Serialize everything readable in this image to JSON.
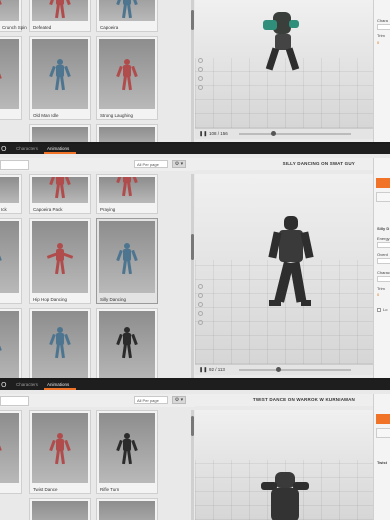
{
  "panel1": {
    "tiles_top": [
      {
        "label": "Crunch Spin"
      },
      {
        "label": "Defeated"
      },
      {
        "label": "Capoeira"
      }
    ],
    "tiles_mid": [
      {
        "label": ""
      },
      {
        "label": "Old Man Idle"
      },
      {
        "label": "Strong Laughing"
      }
    ],
    "player": {
      "frames": "108 / 156",
      "progress": 0.3
    }
  },
  "panel2": {
    "topbar": {
      "logo": "O",
      "tab_characters": "Characters",
      "tab_animations": "Animations"
    },
    "toolbar": {
      "per_page": "All Per page",
      "gear": "⚙ ▾"
    },
    "viewer_title": "SILLY DANCING ON SWAT GUY",
    "tiles_row1": [
      {
        "label": "Ick"
      },
      {
        "label": "Capoeira Pack"
      },
      {
        "label": "Praying"
      }
    ],
    "tiles_row2": [
      {
        "label": ""
      },
      {
        "label": "Hip Hop Dancing"
      },
      {
        "label": "Silly Dancing"
      }
    ],
    "player": {
      "frames": "92 / 113",
      "progress": 0.35
    },
    "settings": {
      "label_silly": "Silly D",
      "energy": "Energy",
      "overdrive": "Overd",
      "character_arm": "Charac",
      "trim": "Trim",
      "in_place": "Lo",
      "field_value_1": "0",
      "field_value_2": "0"
    }
  },
  "panel3": {
    "topbar": {
      "logo": "O",
      "tab_characters": "Characters",
      "tab_animations": "Animations"
    },
    "toolbar": {
      "per_page": "All Per page",
      "gear": "⚙ ▾"
    },
    "viewer_title": "TWIST DANCE ON WARROK W KURNIAWAN",
    "tiles_row1": [
      {
        "label": ""
      },
      {
        "label": "Twist Dance"
      },
      {
        "label": "Rifle Turn"
      }
    ],
    "settings": {
      "label_twist": "Twist"
    }
  },
  "panel1_settings": {
    "character": "Chara",
    "trim": "Trim",
    "value": "0"
  },
  "colors": {
    "accent": "#f07328",
    "topbar": "#1e1e1e"
  },
  "icons": [
    "pause-icon",
    "gear-icon",
    "search-icon"
  ]
}
